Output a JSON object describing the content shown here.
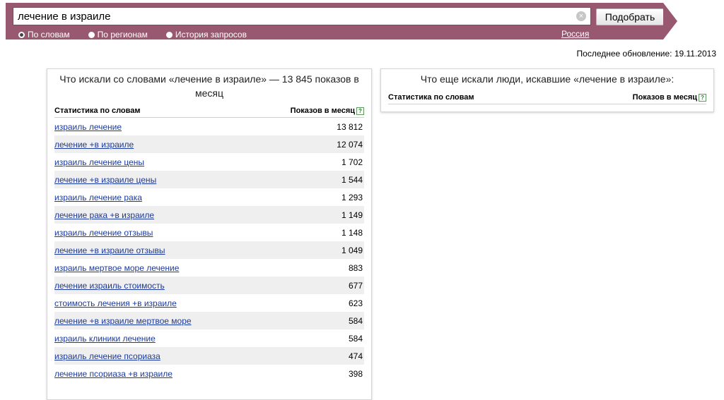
{
  "search": {
    "query": "лечение в израиле",
    "clear_icon": "close-icon",
    "submit_label": "Подобрать"
  },
  "modes": [
    {
      "label": "По словам",
      "checked": true
    },
    {
      "label": "По регионам",
      "checked": false
    },
    {
      "label": "История запросов",
      "checked": false
    }
  ],
  "region": "Россия",
  "last_update": "Последнее обновление: 19.11.2013",
  "left_panel": {
    "title": "Что искали со словами «лечение в израиле» — 13 845 показов в месяц",
    "col_words": "Статистика по словам",
    "col_shows": "Показов в месяц",
    "rows": [
      {
        "phrase": "израиль лечение",
        "count": "13 812"
      },
      {
        "phrase": "лечение +в израиле",
        "count": "12 074"
      },
      {
        "phrase": "израиль лечение цены",
        "count": "1 702"
      },
      {
        "phrase": "лечение +в израиле цены",
        "count": "1 544"
      },
      {
        "phrase": "израиль лечение рака",
        "count": "1 293"
      },
      {
        "phrase": "лечение рака +в израиле",
        "count": "1 149"
      },
      {
        "phrase": "израиль лечение отзывы",
        "count": "1 148"
      },
      {
        "phrase": "лечение +в израиле отзывы",
        "count": "1 049"
      },
      {
        "phrase": "израиль мертвое море лечение",
        "count": "883"
      },
      {
        "phrase": "лечение израиль стоимость",
        "count": "677"
      },
      {
        "phrase": "стоимость лечения +в израиле",
        "count": "623"
      },
      {
        "phrase": "лечение +в израиле мертвое море",
        "count": "584"
      },
      {
        "phrase": "израиль клиники лечение",
        "count": "584"
      },
      {
        "phrase": "израиль лечение псориаза",
        "count": "474"
      },
      {
        "phrase": "лечение псориаза +в израиле",
        "count": "398"
      }
    ]
  },
  "right_panel": {
    "title": "Что еще искали люди, искавшие «лечение в израиле»:",
    "col_words": "Статистика по словам",
    "col_shows": "Показов в месяц"
  },
  "colors": {
    "band": "#98586f",
    "link": "#1c3a9c",
    "stripe": "#efefef"
  }
}
